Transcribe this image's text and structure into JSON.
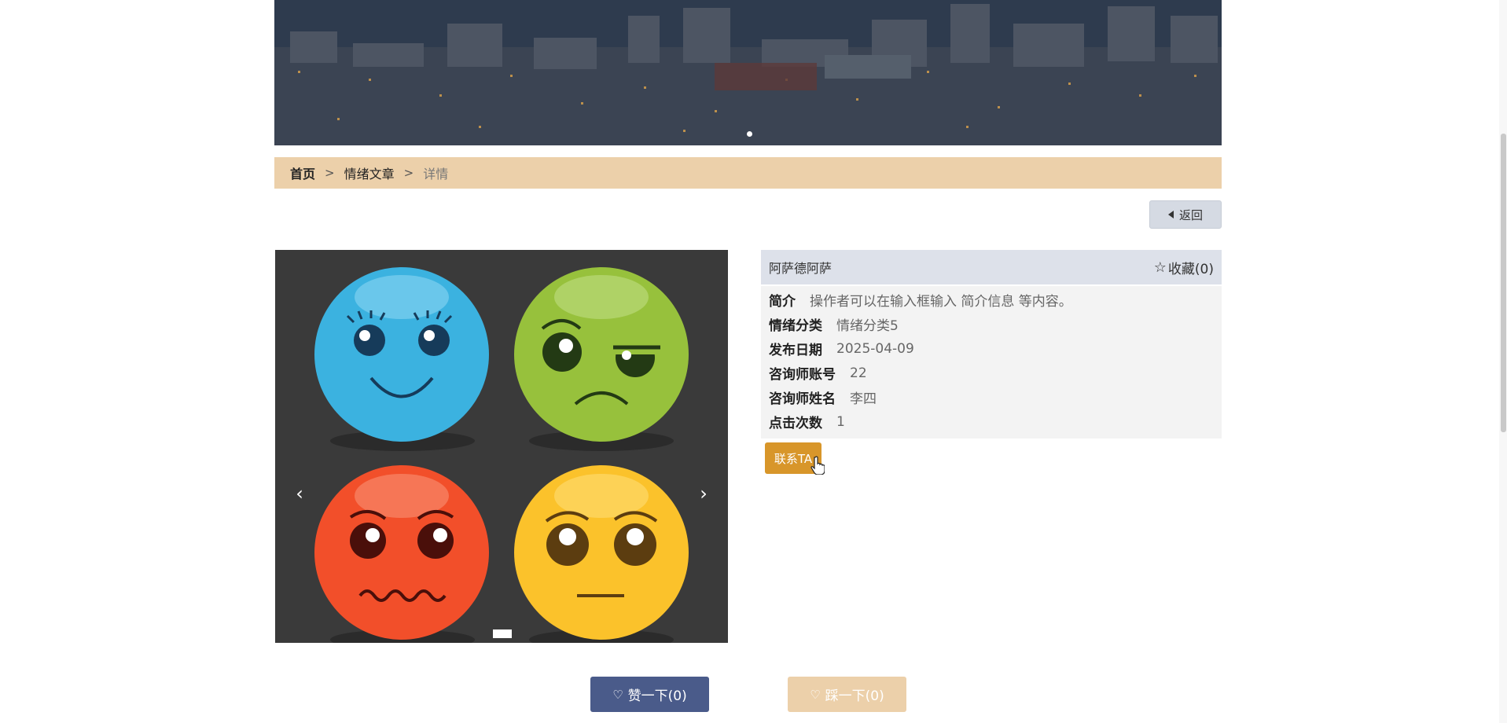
{
  "breadcrumb": {
    "home": "首页",
    "separator": ">",
    "section": "情绪文章",
    "current": "详情"
  },
  "back_button": {
    "label": "返回"
  },
  "article": {
    "title": "阿萨德阿萨",
    "favorite_label": "收藏(0)",
    "fields": [
      {
        "label": "简介",
        "value": "操作者可以在输入框输入 简介信息 等内容。"
      },
      {
        "label": "情绪分类",
        "value": "情绪分类5"
      },
      {
        "label": "发布日期",
        "value": "2025-04-09"
      },
      {
        "label": "咨询师账号",
        "value": "22"
      },
      {
        "label": "咨询师姓名",
        "value": "李四"
      },
      {
        "label": "点击次数",
        "value": "1"
      }
    ],
    "contact_button": "联系TA"
  },
  "carousel": {
    "prev_icon": "chevron-left-icon",
    "next_icon": "chevron-right-icon",
    "prev_glyph": "‹",
    "next_glyph": "›"
  },
  "votes": {
    "like_label": "赞一下(0)",
    "dislike_label": "踩一下(0)"
  },
  "colors": {
    "breadcrumb_bg": "#ecd0aa",
    "contact_button": "#d8962a",
    "like_button": "#4a5b8a",
    "dislike_button": "#ecd0aa",
    "panel_head": "#dde1ea"
  }
}
